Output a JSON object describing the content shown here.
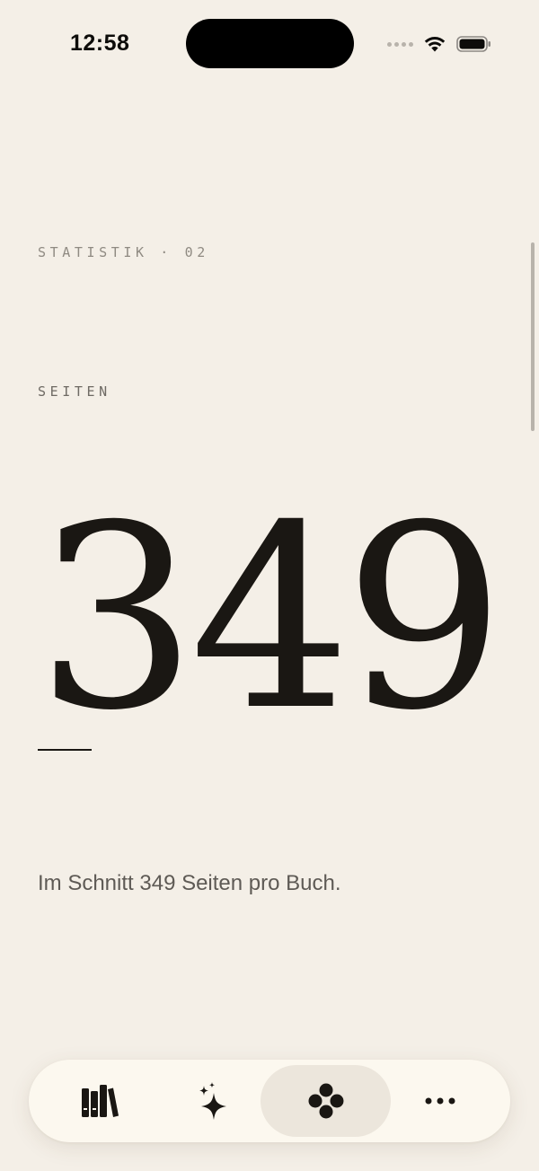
{
  "status_bar": {
    "time": "12:58"
  },
  "stat": {
    "eyebrow": "STATISTIK · 02",
    "label": "SEITEN",
    "value": "349",
    "description": "Im Schnitt 349 Seiten pro Buch."
  },
  "tab_bar": {
    "active_index": 2,
    "tabs": [
      {
        "icon": "library-books-icon"
      },
      {
        "icon": "sparkles-icon"
      },
      {
        "icon": "four-dots-icon"
      },
      {
        "icon": "more-ellipsis-icon"
      }
    ]
  },
  "colors": {
    "background": "#f4efe7",
    "text": "#1a1713",
    "muted": "#8f8a82",
    "tab_bar": "#fcf8ef",
    "tab_active": "#ece6dc"
  }
}
